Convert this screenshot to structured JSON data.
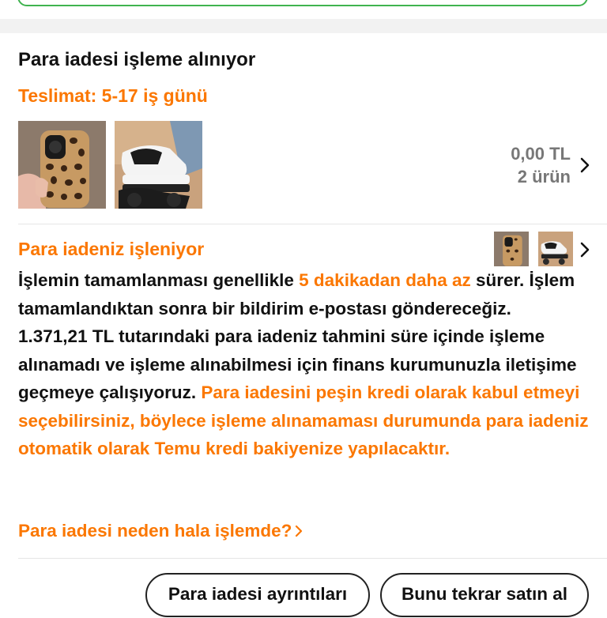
{
  "order": {
    "title": "Para iadesi işleme alınıyor",
    "delivery": "Teslimat: 5-17 iş günü",
    "amount": "0,00 TL",
    "item_count": "2 ürün"
  },
  "refund": {
    "status_title": "Para iadeniz işleniyor",
    "text_1": "İşlemin tamamlanması genellikle ",
    "text_1_highlight": "5 dakikadan daha az",
    "text_2": " sürer. İşlem tamamlandıktan sonra bir bildirim e-postası göndereceğiz.",
    "text_3": "1.371,21 TL tutarındaki para iadeniz tahmini süre içinde işleme alınamadı ve işleme alınabilmesi için finans kurumunuzla iletişime geçmeye çalışıyoruz. ",
    "text_3_highlight": "Para iadesini peşin kredi olarak kabul etmeyi seçebilirsiniz, böylece işleme alınamaması durumunda para iadeniz otomatik olarak Temu kredi bakiyenize yapılacaktır.",
    "why_link": "Para iadesi neden hala işlemde?"
  },
  "buttons": {
    "details": "Para iadesi ayrıntıları",
    "rebuy": "Bunu tekrar satın al"
  },
  "icons": {
    "chevron": "chevron-right-icon",
    "product_1": "leopard-phone-case-image",
    "product_2": "black-white-sneaker-image"
  },
  "colors": {
    "accent": "#fb7701",
    "success_border": "#3fb34f",
    "muted": "#777777"
  }
}
